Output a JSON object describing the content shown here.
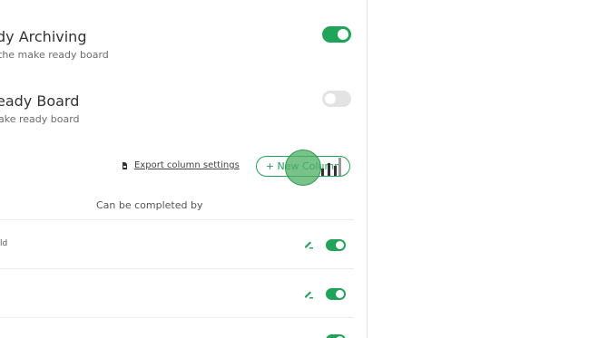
{
  "settings": [
    {
      "title": "dy Archiving",
      "description": "the make ready board",
      "toggle_on": true
    },
    {
      "title": "eady Board",
      "description": "ake ready board",
      "toggle_on": false
    }
  ],
  "toolbar": {
    "export_label": "Export column settings",
    "new_column_label": "+ New Column"
  },
  "table": {
    "column_header": "Can be completed by",
    "rows": [
      {
        "text": "ld",
        "toggle_on": true
      },
      {
        "text": "",
        "toggle_on": true
      }
    ]
  },
  "colors": {
    "accent": "#1fa55a",
    "toggle_off": "#e3e3e3"
  }
}
